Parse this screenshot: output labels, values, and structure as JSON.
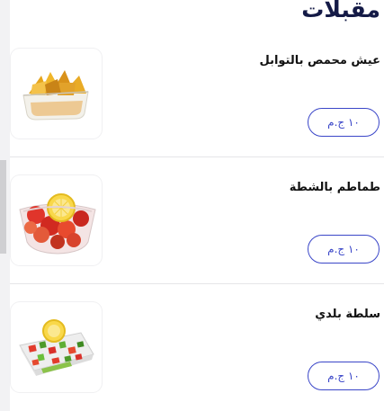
{
  "section": {
    "title": "مقبلات"
  },
  "items": [
    {
      "name": "عيش محمص بالتوابل",
      "price": "١٠ ج.م",
      "image": "toasted-bread-chips-image"
    },
    {
      "name": "طماطم بالشطة",
      "price": "١٠ ج.م",
      "image": "spicy-tomato-bowl-image"
    },
    {
      "name": "سلطة بلدي",
      "price": "١٠ ج.م",
      "image": "baladi-salad-box-image"
    }
  ],
  "colors": {
    "accent": "#3a46c8",
    "title": "#141a46",
    "background": "#f2f2f4"
  }
}
